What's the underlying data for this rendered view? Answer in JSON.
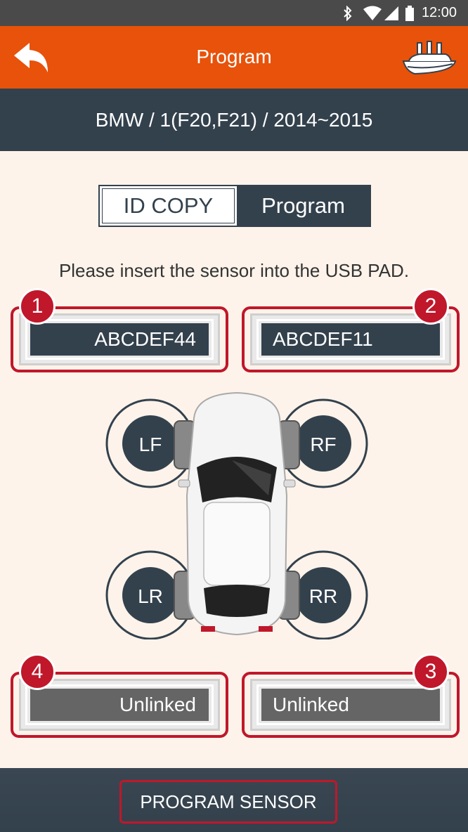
{
  "status": {
    "time": "12:00"
  },
  "appbar": {
    "title": "Program"
  },
  "vehicle": {
    "path": "BMW / 1(F20,F21) / 2014~2015"
  },
  "tabs": [
    {
      "label": "ID COPY",
      "active": false
    },
    {
      "label": "Program",
      "active": true
    }
  ],
  "instruction": "Please insert the sensor into the USB PAD.",
  "slots": [
    {
      "number": "1",
      "value": "ABCDEF44"
    },
    {
      "number": "2",
      "value": "ABCDEF11"
    },
    {
      "number": "3",
      "value": "Unlinked"
    },
    {
      "number": "4",
      "value": "Unlinked"
    }
  ],
  "wheels": {
    "lf": "LF",
    "rf": "RF",
    "lr": "LR",
    "rr": "RR"
  },
  "program_button": "PROGRAM SENSOR",
  "colors": {
    "accent": "#e8520a",
    "dark": "#33414d",
    "highlight": "#c0172a",
    "background": "#fdf3ea"
  }
}
